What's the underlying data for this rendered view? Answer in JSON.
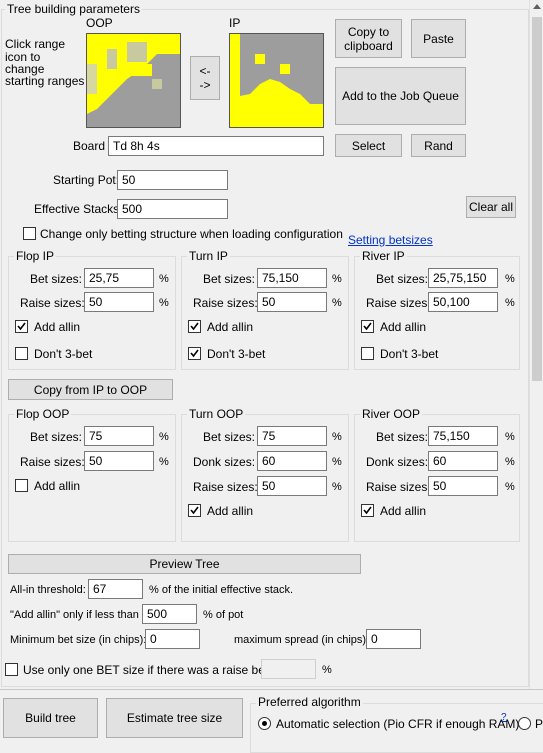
{
  "main_group_title": "Tree building parameters",
  "range_hint": [
    "Click range",
    "icon to",
    "change",
    "starting ranges"
  ],
  "oop_label": "OOP",
  "ip_label": "IP",
  "swap_label": "<-\n->",
  "buttons": {
    "copy_clipboard": "Copy to\nclipboard",
    "paste": "Paste",
    "add_job_queue": "Add to the Job Queue",
    "select": "Select",
    "rand": "Rand",
    "clear_all": "Clear all",
    "copy_ip_to_oop": "Copy from IP to OOP",
    "preview_tree": "Preview Tree",
    "build_tree": "Build tree",
    "estimate_tree_size": "Estimate tree size"
  },
  "board": {
    "label": "Board",
    "value": "Td 8h 4s"
  },
  "starting_pot": {
    "label": "Starting Pot:",
    "value": "50"
  },
  "effective_stacks": {
    "label": "Effective Stacks",
    "value": "500"
  },
  "change_only_betting": {
    "label": "Change only betting structure when loading configuration",
    "checked": false
  },
  "setting_betsizes_link": "Setting betsizes",
  "flop_ip": {
    "title": "Flop IP",
    "bet_label": "Bet sizes:",
    "bet": "25,75",
    "raise_label": "Raise sizes:",
    "raise": "50",
    "add_allin": "Add allin",
    "add_allin_checked": true,
    "dont3bet": "Don't 3-bet",
    "dont3bet_checked": false
  },
  "turn_ip": {
    "title": "Turn IP",
    "bet_label": "Bet sizes:",
    "bet": "75,150",
    "raise_label": "Raise sizes:",
    "raise": "50",
    "add_allin": "Add allin",
    "add_allin_checked": true,
    "dont3bet": "Don't 3-bet",
    "dont3bet_checked": true
  },
  "river_ip": {
    "title": "River IP",
    "bet_label": "Bet sizes:",
    "bet": "25,75,150",
    "raise_label": "Raise sizes:",
    "raise": "50,100",
    "add_allin": "Add allin",
    "add_allin_checked": true,
    "dont3bet": "Don't 3-bet",
    "dont3bet_checked": false
  },
  "flop_oop": {
    "title": "Flop OOP",
    "bet_label": "Bet sizes:",
    "bet": "75",
    "raise_label": "Raise sizes:",
    "raise": "50",
    "add_allin": "Add allin",
    "add_allin_checked": false
  },
  "turn_oop": {
    "title": "Turn OOP",
    "bet_label": "Bet sizes:",
    "bet": "75",
    "donk_label": "Donk sizes:",
    "donk": "60",
    "raise_label": "Raise sizes:",
    "raise": "50",
    "add_allin": "Add allin",
    "add_allin_checked": true
  },
  "river_oop": {
    "title": "River OOP",
    "bet_label": "Bet sizes:",
    "bet": "75,150",
    "donk_label": "Donk sizes:",
    "donk": "60",
    "raise_label": "Raise sizes:",
    "raise": "50",
    "add_allin": "Add allin",
    "add_allin_checked": true
  },
  "pct": "%",
  "allin_threshold": {
    "label": "All-in threshold:",
    "value": "67",
    "suffix": "% of the initial effective stack."
  },
  "add_allin_if": {
    "label": "\"Add allin\" only if less than",
    "value": "500",
    "suffix": "% of pot"
  },
  "min_bet": {
    "label": "Minimum bet size (in chips):",
    "value": "0"
  },
  "max_spread": {
    "label": "maximum spread (in chips)",
    "value": "0"
  },
  "one_bet_size": {
    "label": "Use only one BET size if there was a raise before",
    "value": "",
    "suffix": "%",
    "checked": false
  },
  "preferred_algorithm": {
    "title": "Preferred algorithm",
    "option1": "Automatic selection (Pio CFR if enough RAM)",
    "help": "?",
    "option2": "P"
  },
  "colors": {
    "range_on": "#ffff00",
    "range_off": "#9d9d9d",
    "range_mid": "#c9c9a0"
  }
}
